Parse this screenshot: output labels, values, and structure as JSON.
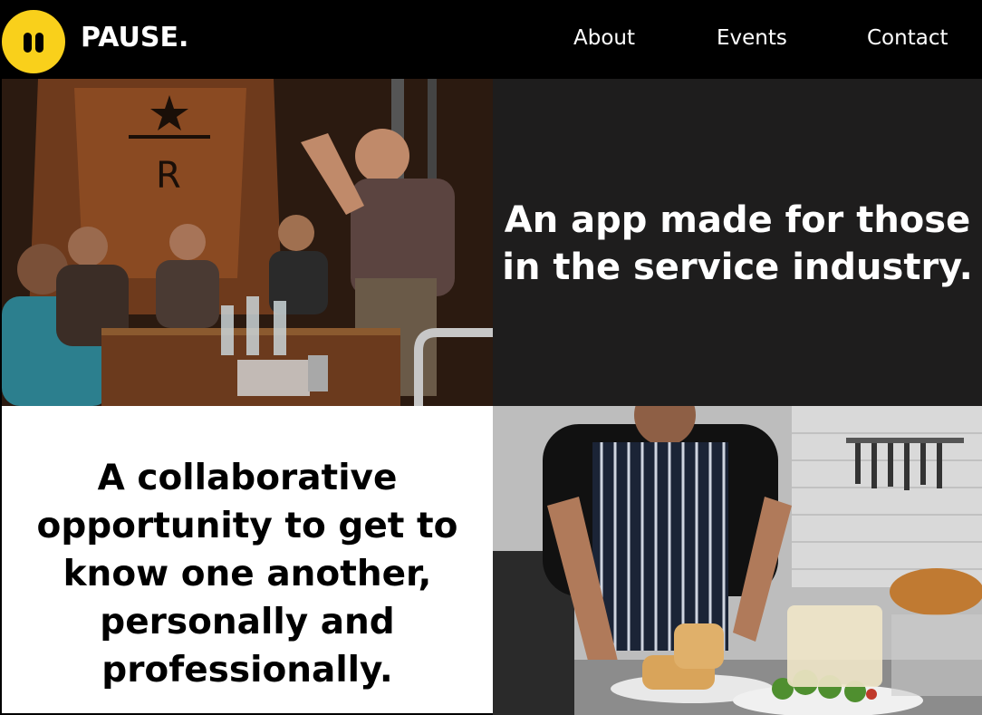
{
  "header": {
    "brand": "PAUSE.",
    "logo_color": "#f9d01b",
    "nav": [
      {
        "label": "About"
      },
      {
        "label": "Events"
      },
      {
        "label": "Contact"
      }
    ]
  },
  "hero": {
    "photo_top_left": {
      "icon": "bartender-photo",
      "alt": ""
    },
    "headline_primary": "An app made for those in the service industry.",
    "headline_secondary": "A collaborative opportunity to get to know one another, personally and professionally.",
    "photo_bottom_right": {
      "icon": "chef-photo",
      "alt": ""
    }
  },
  "colors": {
    "background": "#000000",
    "dark_panel": "#1e1d1d",
    "white_panel": "#ffffff",
    "accent": "#f9d01b"
  }
}
